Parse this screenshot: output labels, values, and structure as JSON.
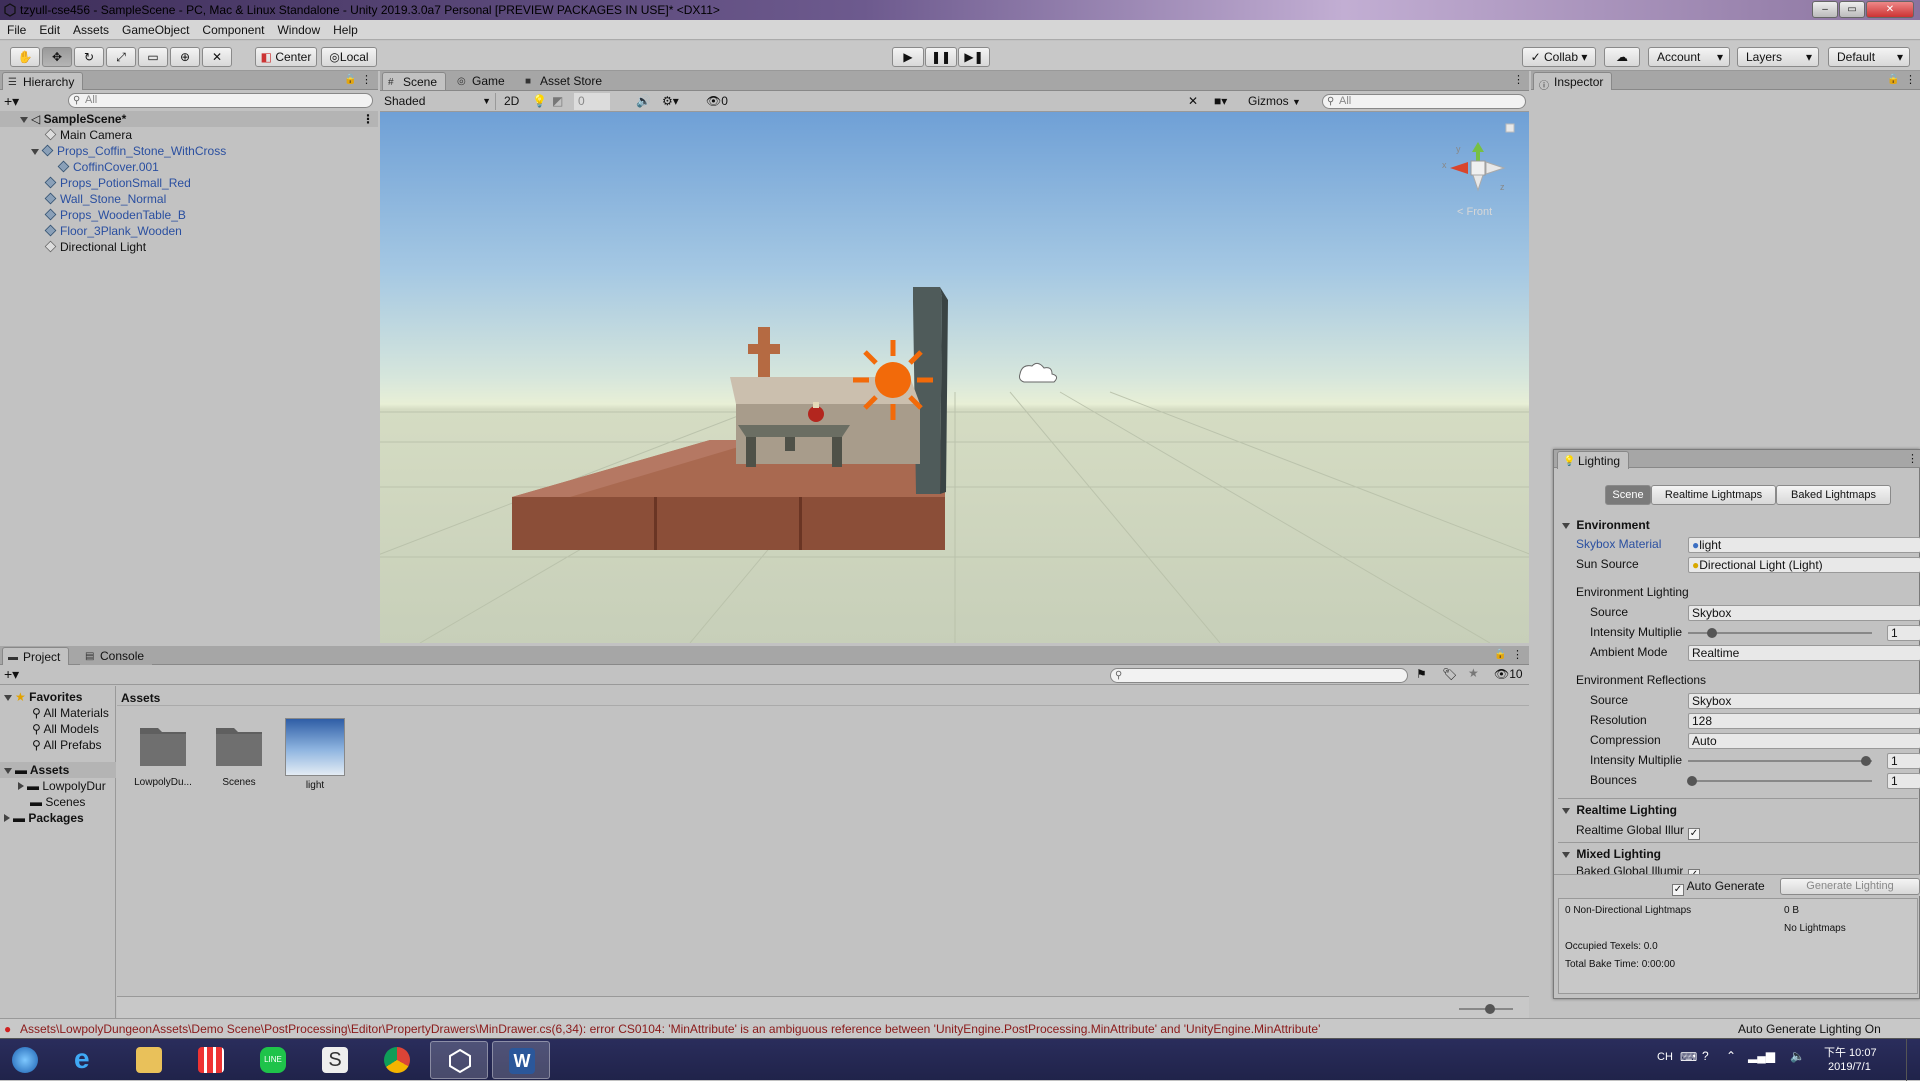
{
  "window": {
    "title": "tzyull-cse456 - SampleScene - PC, Mac & Linux Standalone - Unity 2019.3.0a7 Personal [PREVIEW PACKAGES IN USE]* <DX11>",
    "buttons": {
      "minimize": "–",
      "restore": "▭",
      "close": "✕"
    }
  },
  "menu": [
    "File",
    "Edit",
    "Assets",
    "GameObject",
    "Component",
    "Window",
    "Help"
  ],
  "toolbar": {
    "pivot": "Center",
    "space": "Local",
    "collab": "Collab",
    "account": "Account",
    "layers": "Layers",
    "layout": "Default"
  },
  "hierarchy": {
    "tab": "Hierarchy",
    "search_placeholder": "All",
    "scene_name": "SampleScene*",
    "items": [
      {
        "label": "Main Camera",
        "kind": "plain"
      },
      {
        "label": "Props_Coffin_Stone_WithCross",
        "kind": "prefab"
      },
      {
        "label": "CoffinCover.001",
        "kind": "prefab"
      },
      {
        "label": "Props_PotionSmall_Red",
        "kind": "prefab"
      },
      {
        "label": "Wall_Stone_Normal",
        "kind": "prefab"
      },
      {
        "label": "Props_WoodenTable_B",
        "kind": "prefab"
      },
      {
        "label": "Floor_3Plank_Wooden",
        "kind": "prefab"
      },
      {
        "label": "Directional Light",
        "kind": "plain"
      }
    ]
  },
  "scene_view": {
    "tabs": [
      "Scene",
      "Game",
      "Asset Store"
    ],
    "shading": "Shaded",
    "mode_2d": "2D",
    "fx_count": "0",
    "hidden_count": "0",
    "gizmos": "Gizmos",
    "search_placeholder": "All",
    "orientation_label": "< Front",
    "axis_labels": {
      "y": "y",
      "x": "x",
      "z": "z"
    }
  },
  "inspector": {
    "tab": "Inspector"
  },
  "lighting": {
    "title": "Lighting",
    "tabs": [
      "Scene",
      "Realtime Lightmaps",
      "Baked Lightmaps"
    ],
    "environment_header": "Environment",
    "skybox_material_label": "Skybox Material",
    "skybox_material_value": "light",
    "sun_source_label": "Sun Source",
    "sun_source_value": "Directional Light (Light)",
    "env_lighting_header": "Environment Lighting",
    "env_source_label": "Source",
    "env_source_value": "Skybox",
    "env_intensity_label": "Intensity Multiplie",
    "env_intensity_value": "1",
    "ambient_mode_label": "Ambient Mode",
    "ambient_mode_value": "Realtime",
    "env_reflections_header": "Environment Reflections",
    "refl_source_label": "Source",
    "refl_source_value": "Skybox",
    "resolution_label": "Resolution",
    "resolution_value": "128",
    "compression_label": "Compression",
    "compression_value": "Auto",
    "refl_intensity_label": "Intensity Multiplie",
    "refl_intensity_value": "1",
    "bounces_label": "Bounces",
    "bounces_value": "1",
    "realtime_header": "Realtime Lighting",
    "realtime_gi_label": "Realtime Global Illur",
    "mixed_header": "Mixed Lighting",
    "baked_gi_label": "Baked Global Illumir",
    "auto_generate_label": "Auto Generate",
    "generate_button": "Generate Lighting",
    "stats": {
      "non_directional": "0 Non-Directional Lightmaps",
      "size": "0 B",
      "no_lightmaps": "No Lightmaps",
      "occupied": "Occupied Texels: 0.0",
      "bake_time": "Total Bake Time: 0:00:00"
    },
    "slider_levels": {
      "env_intensity": 0.13,
      "refl_intensity": 0.97,
      "bounces": 0.02
    }
  },
  "project": {
    "tabs": [
      "Project",
      "Console"
    ],
    "hidden_count": "10",
    "favorites_header": "Favorites",
    "favorites": [
      "All Materials",
      "All Models",
      "All Prefabs"
    ],
    "assets_header": "Assets",
    "assets_tree": [
      "LowpolyDur",
      "Scenes"
    ],
    "packages_header": "Packages",
    "breadcrumb": "Assets",
    "grid_items": [
      {
        "label": "LowpolyDu...",
        "kind": "folder"
      },
      {
        "label": "Scenes",
        "kind": "folder"
      },
      {
        "label": "light",
        "kind": "material"
      }
    ]
  },
  "status": {
    "error": "Assets\\LowpolyDungeonAssets\\Demo Scene\\PostProcessing\\Editor\\PropertyDrawers\\MinDrawer.cs(6,34): error CS0104: 'MinAttribute' is an ambiguous reference between 'UnityEngine.PostProcessing.MinAttribute' and 'UnityEngine.MinAttribute'",
    "right": "Auto Generate Lighting On"
  },
  "taskbar": {
    "ime": "CH",
    "time": "下午 10:07",
    "date": "2019/7/1"
  },
  "colors": {
    "accent_blue": "#3c6fc2",
    "error_red": "#d02020",
    "sun_orange": "#f26a0a"
  }
}
